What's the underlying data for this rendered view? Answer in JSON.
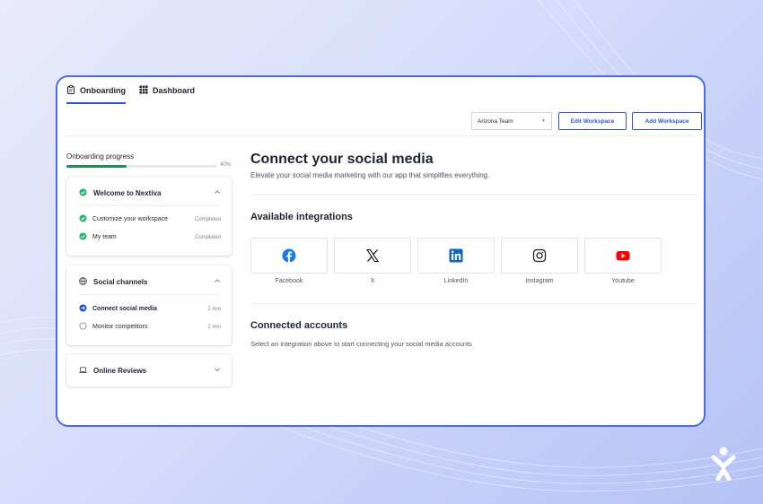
{
  "header": {
    "tabs": [
      {
        "label": "Onboarding",
        "icon": "clipboard-icon",
        "active": true
      },
      {
        "label": "Dashboard",
        "icon": "grid-icon",
        "active": false
      }
    ],
    "workspace_select": {
      "value": "Arizona Team"
    },
    "edit_workspace_label": "Edit Workspace",
    "add_workspace_label": "Add Workspace"
  },
  "sidebar": {
    "progress_label": "Onboarding progress",
    "progress_value": 0.4,
    "progress_text": "40%",
    "sections": [
      {
        "title": "Welcome to Nextiva",
        "icon": "check-circle-icon",
        "expanded": true,
        "items": [
          {
            "label": "Customize your workspace",
            "meta": "Completed",
            "status": "completed"
          },
          {
            "label": "My team",
            "meta": "Completed",
            "status": "completed"
          }
        ]
      },
      {
        "title": "Social channels",
        "icon": "globe-icon",
        "expanded": true,
        "items": [
          {
            "label": "Connect social media",
            "meta": "2 min",
            "status": "current"
          },
          {
            "label": "Monitor competitors",
            "meta": "2 min",
            "status": "pending"
          }
        ]
      },
      {
        "title": "Online Reviews",
        "icon": "laptop-icon",
        "expanded": false,
        "items": []
      }
    ]
  },
  "main": {
    "title": "Connect your social media",
    "subtitle": "Elevate your social media marketing with our app that simplifies everything.",
    "integrations_title": "Available integrations",
    "integrations": [
      {
        "label": "Facebook",
        "icon": "facebook-icon",
        "color": "#1877f2"
      },
      {
        "label": "X",
        "icon": "x-icon",
        "color": "#111111"
      },
      {
        "label": "LinkedIn",
        "icon": "linkedin-icon",
        "color": "#0a66c2"
      },
      {
        "label": "Instagram",
        "icon": "instagram-icon",
        "color": "#222222"
      },
      {
        "label": "Youtube",
        "icon": "youtube-icon",
        "color": "#ff0000"
      }
    ],
    "connected_title": "Connected accounts",
    "connected_subtitle": "Select an integration above to start connecting your social media accounts"
  },
  "colors": {
    "accent": "#2c55d6",
    "progress": "#1a8f56",
    "completed": "#22b573",
    "current": "#2c55d6"
  }
}
